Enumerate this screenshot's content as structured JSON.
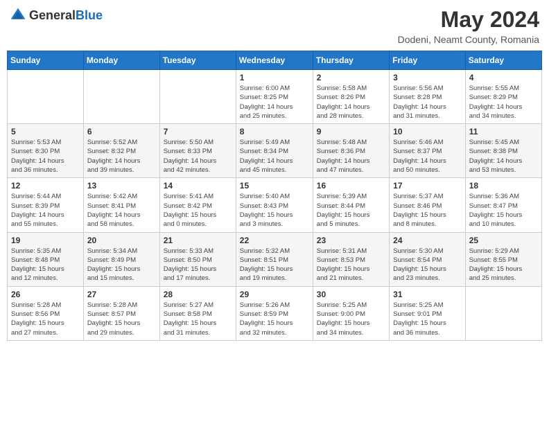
{
  "header": {
    "logo_general": "General",
    "logo_blue": "Blue",
    "month_year": "May 2024",
    "location": "Dodeni, Neamt County, Romania"
  },
  "days_of_week": [
    "Sunday",
    "Monday",
    "Tuesday",
    "Wednesday",
    "Thursday",
    "Friday",
    "Saturday"
  ],
  "weeks": [
    [
      {
        "day": "",
        "info": ""
      },
      {
        "day": "",
        "info": ""
      },
      {
        "day": "",
        "info": ""
      },
      {
        "day": "1",
        "info": "Sunrise: 6:00 AM\nSunset: 8:25 PM\nDaylight: 14 hours\nand 25 minutes."
      },
      {
        "day": "2",
        "info": "Sunrise: 5:58 AM\nSunset: 8:26 PM\nDaylight: 14 hours\nand 28 minutes."
      },
      {
        "day": "3",
        "info": "Sunrise: 5:56 AM\nSunset: 8:28 PM\nDaylight: 14 hours\nand 31 minutes."
      },
      {
        "day": "4",
        "info": "Sunrise: 5:55 AM\nSunset: 8:29 PM\nDaylight: 14 hours\nand 34 minutes."
      }
    ],
    [
      {
        "day": "5",
        "info": "Sunrise: 5:53 AM\nSunset: 8:30 PM\nDaylight: 14 hours\nand 36 minutes."
      },
      {
        "day": "6",
        "info": "Sunrise: 5:52 AM\nSunset: 8:32 PM\nDaylight: 14 hours\nand 39 minutes."
      },
      {
        "day": "7",
        "info": "Sunrise: 5:50 AM\nSunset: 8:33 PM\nDaylight: 14 hours\nand 42 minutes."
      },
      {
        "day": "8",
        "info": "Sunrise: 5:49 AM\nSunset: 8:34 PM\nDaylight: 14 hours\nand 45 minutes."
      },
      {
        "day": "9",
        "info": "Sunrise: 5:48 AM\nSunset: 8:36 PM\nDaylight: 14 hours\nand 47 minutes."
      },
      {
        "day": "10",
        "info": "Sunrise: 5:46 AM\nSunset: 8:37 PM\nDaylight: 14 hours\nand 50 minutes."
      },
      {
        "day": "11",
        "info": "Sunrise: 5:45 AM\nSunset: 8:38 PM\nDaylight: 14 hours\nand 53 minutes."
      }
    ],
    [
      {
        "day": "12",
        "info": "Sunrise: 5:44 AM\nSunset: 8:39 PM\nDaylight: 14 hours\nand 55 minutes."
      },
      {
        "day": "13",
        "info": "Sunrise: 5:42 AM\nSunset: 8:41 PM\nDaylight: 14 hours\nand 58 minutes."
      },
      {
        "day": "14",
        "info": "Sunrise: 5:41 AM\nSunset: 8:42 PM\nDaylight: 15 hours\nand 0 minutes."
      },
      {
        "day": "15",
        "info": "Sunrise: 5:40 AM\nSunset: 8:43 PM\nDaylight: 15 hours\nand 3 minutes."
      },
      {
        "day": "16",
        "info": "Sunrise: 5:39 AM\nSunset: 8:44 PM\nDaylight: 15 hours\nand 5 minutes."
      },
      {
        "day": "17",
        "info": "Sunrise: 5:37 AM\nSunset: 8:46 PM\nDaylight: 15 hours\nand 8 minutes."
      },
      {
        "day": "18",
        "info": "Sunrise: 5:36 AM\nSunset: 8:47 PM\nDaylight: 15 hours\nand 10 minutes."
      }
    ],
    [
      {
        "day": "19",
        "info": "Sunrise: 5:35 AM\nSunset: 8:48 PM\nDaylight: 15 hours\nand 12 minutes."
      },
      {
        "day": "20",
        "info": "Sunrise: 5:34 AM\nSunset: 8:49 PM\nDaylight: 15 hours\nand 15 minutes."
      },
      {
        "day": "21",
        "info": "Sunrise: 5:33 AM\nSunset: 8:50 PM\nDaylight: 15 hours\nand 17 minutes."
      },
      {
        "day": "22",
        "info": "Sunrise: 5:32 AM\nSunset: 8:51 PM\nDaylight: 15 hours\nand 19 minutes."
      },
      {
        "day": "23",
        "info": "Sunrise: 5:31 AM\nSunset: 8:53 PM\nDaylight: 15 hours\nand 21 minutes."
      },
      {
        "day": "24",
        "info": "Sunrise: 5:30 AM\nSunset: 8:54 PM\nDaylight: 15 hours\nand 23 minutes."
      },
      {
        "day": "25",
        "info": "Sunrise: 5:29 AM\nSunset: 8:55 PM\nDaylight: 15 hours\nand 25 minutes."
      }
    ],
    [
      {
        "day": "26",
        "info": "Sunrise: 5:28 AM\nSunset: 8:56 PM\nDaylight: 15 hours\nand 27 minutes."
      },
      {
        "day": "27",
        "info": "Sunrise: 5:28 AM\nSunset: 8:57 PM\nDaylight: 15 hours\nand 29 minutes."
      },
      {
        "day": "28",
        "info": "Sunrise: 5:27 AM\nSunset: 8:58 PM\nDaylight: 15 hours\nand 31 minutes."
      },
      {
        "day": "29",
        "info": "Sunrise: 5:26 AM\nSunset: 8:59 PM\nDaylight: 15 hours\nand 32 minutes."
      },
      {
        "day": "30",
        "info": "Sunrise: 5:25 AM\nSunset: 9:00 PM\nDaylight: 15 hours\nand 34 minutes."
      },
      {
        "day": "31",
        "info": "Sunrise: 5:25 AM\nSunset: 9:01 PM\nDaylight: 15 hours\nand 36 minutes."
      },
      {
        "day": "",
        "info": ""
      }
    ]
  ]
}
